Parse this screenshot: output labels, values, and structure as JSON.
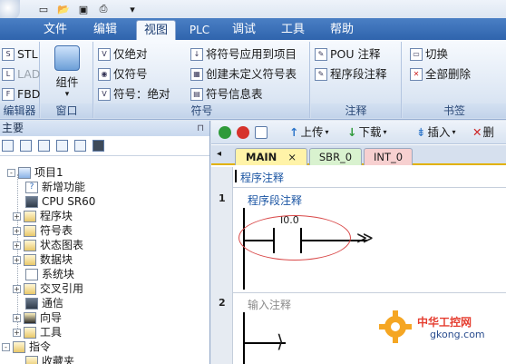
{
  "menu_tabs": [
    "文件",
    "编辑",
    "视图",
    "PLC",
    "调试",
    "工具",
    "帮助"
  ],
  "ribbon": {
    "editor_group": {
      "label": "编辑器",
      "buttons": [
        "STL",
        "LAD",
        "FBD"
      ]
    },
    "window_group": {
      "label": "窗口",
      "component_label": "组件"
    },
    "symbol_group": {
      "label": "符号",
      "buttons": [
        "仅绝对",
        "仅符号",
        "符号：绝对",
        "将符号应用到项目",
        "创建未定义符号表",
        "符号信息表"
      ]
    },
    "comment_group": {
      "label": "注释",
      "buttons": [
        "POU 注释",
        "程序段注释"
      ]
    },
    "bookmark_group": {
      "label": "书签",
      "buttons": [
        "切换",
        "全部删除"
      ]
    }
  },
  "project_panel": {
    "title": "主要",
    "pin_icon": "pin-icon",
    "items": [
      {
        "label": "项目1",
        "expander": "-",
        "icon": "project-icon"
      },
      {
        "label": "新增功能",
        "expander": "",
        "icon": "help-icon"
      },
      {
        "label": "CPU SR60",
        "expander": "",
        "icon": "cpu-icon"
      },
      {
        "label": "程序块",
        "expander": "+",
        "icon": "folder-icon"
      },
      {
        "label": "符号表",
        "expander": "+",
        "icon": "folder-icon"
      },
      {
        "label": "状态图表",
        "expander": "+",
        "icon": "folder-icon"
      },
      {
        "label": "数据块",
        "expander": "+",
        "icon": "folder-icon"
      },
      {
        "label": "系统块",
        "expander": "",
        "icon": "system-block-icon"
      },
      {
        "label": "交叉引用",
        "expander": "+",
        "icon": "folder-icon"
      },
      {
        "label": "通信",
        "expander": "",
        "icon": "communication-icon"
      },
      {
        "label": "向导",
        "expander": "+",
        "icon": "wizard-icon"
      },
      {
        "label": "工具",
        "expander": "+",
        "icon": "folder-icon"
      },
      {
        "label": "指令",
        "expander": "-",
        "icon": "folder-icon"
      },
      {
        "label": "收藏夹",
        "expander": "",
        "icon": "favorites-icon"
      }
    ]
  },
  "editor": {
    "toolbar": {
      "upload": "上传",
      "download": "下载",
      "insert": "插入",
      "delete": "删"
    },
    "tabs": [
      "MAIN",
      "SBR_0",
      "INT_0"
    ],
    "pou_comment": "程序注释",
    "networks": [
      {
        "number": "1",
        "comment": "程序段注释",
        "contact_address": "I0.0"
      },
      {
        "number": "2",
        "comment": "输入注释"
      }
    ]
  },
  "watermark": {
    "text_cn": "中华工控网",
    "text_url": "gkong.com"
  },
  "colors": {
    "tab_bar": "#2f64ad",
    "ribbon_bg": "#dde7f4",
    "highlight_ellipse": "#d94a4a",
    "active_tab_underline": "#e2b200"
  }
}
